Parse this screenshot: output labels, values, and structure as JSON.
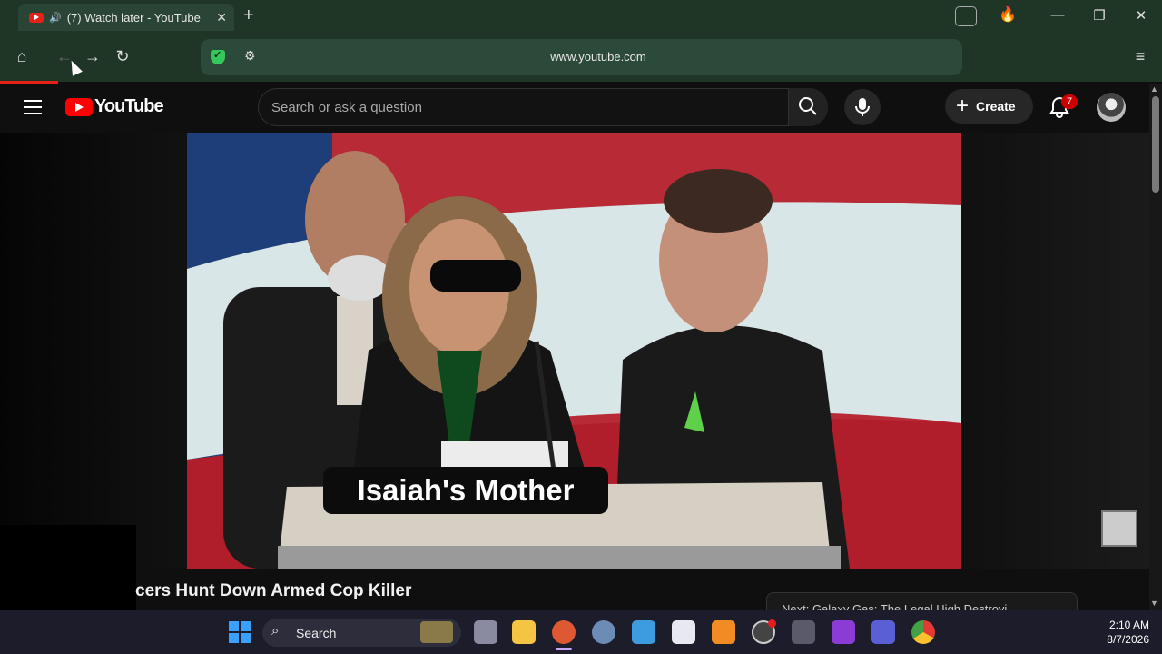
{
  "browser": {
    "tab_title": "(7) Watch later - YouTube",
    "tab_close": "✕",
    "new_tab": "+",
    "url": "www.youtube.com",
    "window_controls": {
      "minimize": "—",
      "restore": "❐",
      "close": "✕"
    },
    "nav": {
      "home": "⌂",
      "back": "←",
      "forward": "→",
      "reload": "↻",
      "menu": "≡"
    }
  },
  "youtube": {
    "logo_text": "YouTube",
    "search_placeholder": "Search or ask a question",
    "create_label": "Create",
    "notification_count": "7"
  },
  "video": {
    "caption_overlay": "Isaiah's Mother",
    "title_visible": "cers Hunt Down Armed Cop Killer",
    "up_next": "Next: Galaxy Gas: The Legal High Destroyi..."
  },
  "taskbar": {
    "search_label": "Search",
    "time": "2:10 AM",
    "date": "8/7/2026"
  },
  "colors": {
    "youtube_red": "#ff0000",
    "browser_chrome": "#1f3526",
    "page_bg": "#0f0f0f"
  }
}
